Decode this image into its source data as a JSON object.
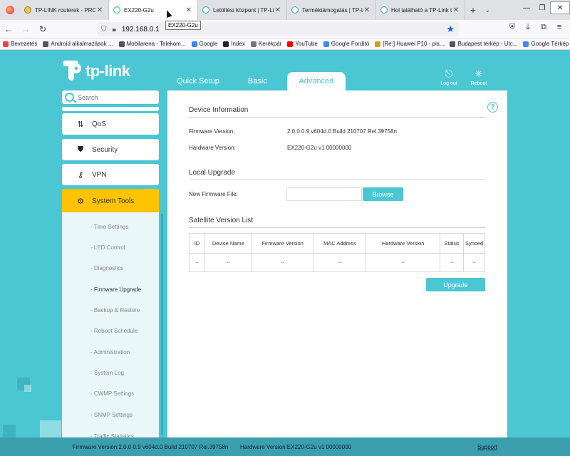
{
  "browser": {
    "tabs": [
      {
        "title": "TP-LINK routerek - PROHARDVER!",
        "icon": "yellow"
      },
      {
        "title": "EX220-G2u",
        "icon": "tp",
        "active": true
      },
      {
        "title": "Letöltési központ | TP-Link",
        "icon": "tp"
      },
      {
        "title": "Terméktámogatás | TP-Link",
        "icon": "tp"
      },
      {
        "title": "Hol található a TP-Link ter...",
        "icon": "tp"
      }
    ],
    "new_tab": "+",
    "tabs_dropdown": "⌄",
    "window_controls": {
      "minimize": "—",
      "maximize": "❐",
      "close": "✕"
    },
    "tooltip": "EX220-G2u",
    "url": "192.168.0.1",
    "bookmarks": [
      {
        "label": "Bevezetés",
        "color": "#e44"
      },
      {
        "label": "Android alkalmazások ...",
        "color": "#555"
      },
      {
        "label": "Mobilarena - Telekom...",
        "color": "#555"
      },
      {
        "label": "Google",
        "color": "#4285f4"
      },
      {
        "label": "Index",
        "color": "#222"
      },
      {
        "label": "Kerékpár",
        "color": "#777"
      },
      {
        "label": "YouTube",
        "color": "#f00"
      },
      {
        "label": "Google Fordító",
        "color": "#4285f4"
      },
      {
        "label": "[Re:] Huawei P10 - pis...",
        "color": "#c9a227"
      },
      {
        "label": "Budapest térkép - Utc...",
        "color": "#555"
      },
      {
        "label": "Google Térkép",
        "color": "#4285f4"
      }
    ]
  },
  "app": {
    "logo_text": "tp-link",
    "tabs": [
      "Quick Setup",
      "Basic",
      "Advanced"
    ],
    "logout_label": "Log out",
    "reboot_label": "Reboot",
    "search_placeholder": "Search",
    "menu": [
      {
        "label": "QoS",
        "icon": "updown-arrows-icon"
      },
      {
        "label": "Security",
        "icon": "shield-icon"
      },
      {
        "label": "VPN",
        "icon": "key-icon"
      },
      {
        "label": "System Tools",
        "icon": "gear-icon"
      }
    ],
    "submenu": [
      "- Time Settings",
      "- LED Control",
      "- Diagnostics",
      "- Firmware Upgrade",
      "- Backup & Restore",
      "- Reboot Schedule",
      "- Administration",
      "- System Log",
      "- CWMP Settings",
      "- SNMP Settings",
      "- Traffic Statistics"
    ],
    "device_info": {
      "title": "Device Information",
      "fw_label": "Firmware Version:",
      "fw_value": "2.0.0 0.9 v604d.0 Build 210707 Rel.39758n",
      "hw_label": "Hardware Version:",
      "hw_value": "EX220-G2u v1 00000000"
    },
    "local_upgrade": {
      "title": "Local Upgrade",
      "file_label": "New Firmware File:",
      "browse": "Browse"
    },
    "satellite": {
      "title": "Satellite Version List",
      "columns": [
        "ID",
        "Device Name",
        "Firmware Version",
        "MAC Address",
        "Hardware Version",
        "Status",
        "Synced"
      ],
      "row": [
        "--",
        "--",
        "--",
        "--",
        "--",
        "--",
        "--"
      ],
      "upgrade": "Upgrade"
    },
    "footer": {
      "fw": "Firmware Version:2.0.0 0.9 v604d.0 Build 210707 Rel.39758n",
      "hw": "Hardware Version:EX220-G2u v1 00000000",
      "support": "Support"
    }
  }
}
